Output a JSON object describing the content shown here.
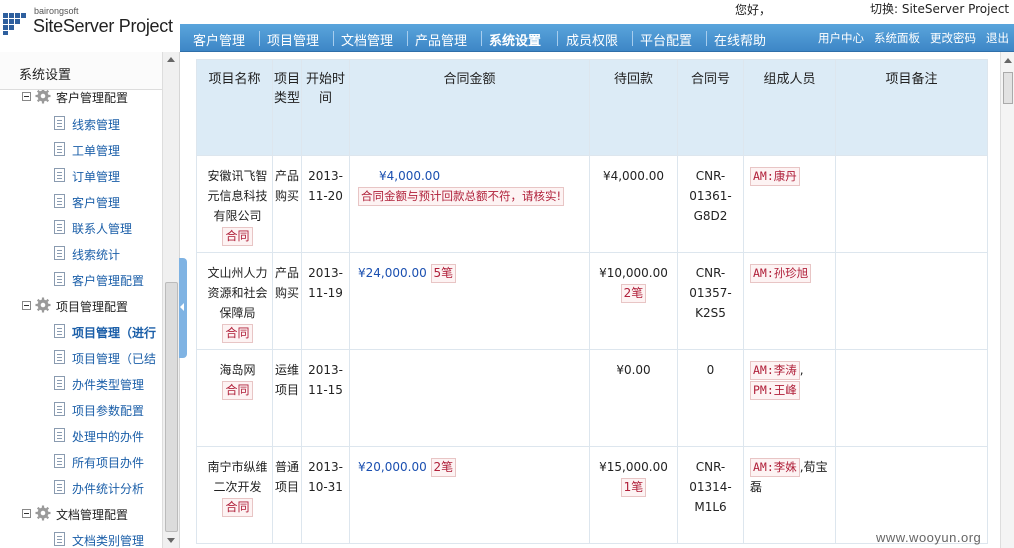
{
  "header": {
    "logo_sub": "bairongsoft",
    "logo_main": "SiteServer Project",
    "user_text": "您好，",
    "switch_text": "切换: SiteServer Project"
  },
  "nav": {
    "items": [
      "客户管理",
      "项目管理",
      "文档管理",
      "产品管理",
      "系统设置",
      "成员权限",
      "平台配置",
      "在线帮助"
    ],
    "active": "系统设置",
    "right": [
      "用户中心",
      "系统面板",
      "更改密码",
      "退出"
    ]
  },
  "sidebar": {
    "title": "系统设置",
    "groups": [
      {
        "label": "客户管理配置",
        "items": [
          "线索管理",
          "工单管理",
          "订单管理",
          "客户管理",
          "联系人管理",
          "线索统计",
          "客户管理配置"
        ]
      },
      {
        "label": "项目管理配置",
        "items": [
          "项目管理（进行",
          "项目管理（已结",
          "办件类型管理",
          "项目参数配置",
          "处理中的办件",
          "所有项目办件",
          "办件统计分析"
        ]
      },
      {
        "label": "文档管理配置",
        "items": [
          "文档类别管理"
        ]
      }
    ]
  },
  "table": {
    "headers": [
      "项目名称",
      "项目类型",
      "开始时间",
      "合同金额",
      "待回款",
      "合同号",
      "组成人员",
      "项目备注"
    ],
    "contract_tag": "合同",
    "rows": [
      {
        "name": "安徽讯飞智元信息科技有限公司",
        "type": "产品购买",
        "date": "2013-11-20",
        "amount": "¥4,000.00",
        "amount_count": "",
        "warning": "合同金额与预计回款总额不符，请核实!",
        "due": "¥4,000.00",
        "due_count": "",
        "contract_no": "CNR-01361-G8D2",
        "members": [
          {
            "tag": "AM:康丹",
            "sep": ""
          }
        ],
        "members_tail": "",
        "note": ""
      },
      {
        "name": "文山州人力资源和社会保障局",
        "type": "产品购买",
        "date": "2013-11-19",
        "amount": "¥24,000.00",
        "amount_count": "5笔",
        "warning": "",
        "due": "¥10,000.00",
        "due_count": "2笔",
        "contract_no": "CNR-01357-K2S5",
        "members": [
          {
            "tag": "AM:孙珍旭",
            "sep": ""
          }
        ],
        "members_tail": "",
        "note": ""
      },
      {
        "name": "海岛网",
        "type": "运维项目",
        "date": "2013-11-15",
        "amount": "",
        "amount_count": "",
        "warning": "",
        "due": "¥0.00",
        "due_count": "",
        "contract_no": "0",
        "members": [
          {
            "tag": "AM:李涛",
            "sep": ","
          },
          {
            "tag": "PM:王峰",
            "sep": ""
          }
        ],
        "members_tail": "",
        "note": ""
      },
      {
        "name": "南宁市纵维二次开发",
        "type": "普通项目",
        "date": "2013-10-31",
        "amount": "¥20,000.00",
        "amount_count": "2笔",
        "warning": "",
        "due": "¥15,000.00",
        "due_count": "1笔",
        "contract_no": "CNR-01314-M1L6",
        "members": [
          {
            "tag": "AM:李姝",
            "sep": ""
          }
        ],
        "members_tail": ",荀宝磊",
        "note": ""
      }
    ]
  },
  "watermark": "www.wooyun.org"
}
